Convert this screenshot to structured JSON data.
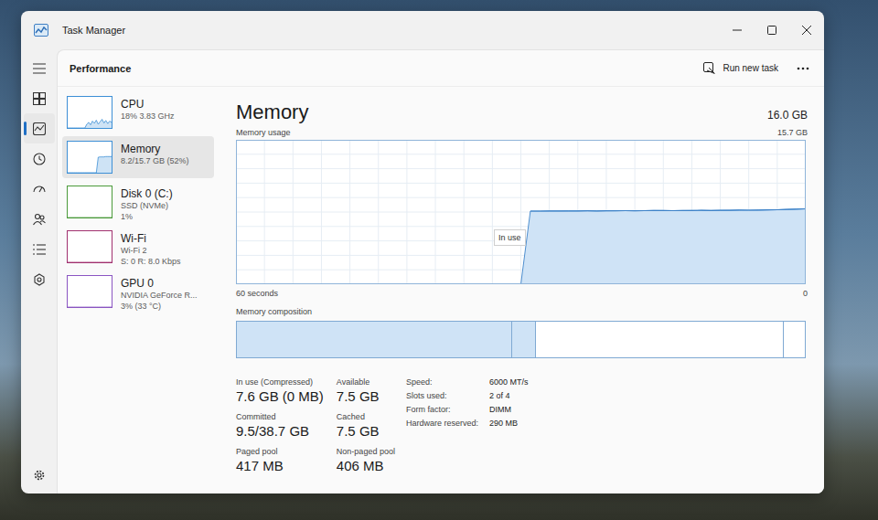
{
  "window": {
    "title": "Task Manager"
  },
  "nav": [
    {
      "kind": "menu",
      "selected": false
    },
    {
      "kind": "processes",
      "selected": false
    },
    {
      "kind": "performance",
      "selected": true
    },
    {
      "kind": "app-history",
      "selected": false
    },
    {
      "kind": "startup",
      "selected": false
    },
    {
      "kind": "users",
      "selected": false
    },
    {
      "kind": "details",
      "selected": false
    },
    {
      "kind": "services",
      "selected": false
    },
    {
      "kind": "settings",
      "selected": false
    }
  ],
  "header": {
    "title": "Performance",
    "run_task": "Run new task"
  },
  "sidebar": {
    "items": [
      {
        "name": "CPU",
        "details": [
          "18% 3.83 GHz"
        ],
        "selected": false,
        "color": "#3d8fd6",
        "values": [
          0,
          0,
          0,
          0,
          0,
          0,
          0,
          0,
          0,
          0,
          12,
          18,
          10,
          22,
          15,
          25,
          12,
          20,
          28,
          16,
          24,
          14,
          22,
          18
        ]
      },
      {
        "name": "Memory",
        "details": [
          "8.2/15.7 GB (52%)"
        ],
        "selected": true,
        "color": "#3d8fd6",
        "values": [
          0,
          0,
          0,
          0,
          0,
          0,
          0,
          0,
          0,
          0,
          0,
          0,
          0,
          0,
          0,
          0,
          50,
          51,
          51,
          51,
          52,
          52,
          52,
          52
        ]
      },
      {
        "name": "Disk 0 (C:)",
        "details": [
          "SSD (NVMe)",
          "1%"
        ],
        "selected": false,
        "color": "#4a9a3a",
        "values": [
          0,
          0,
          0,
          0,
          0,
          0,
          0,
          0,
          0,
          0,
          0,
          0,
          0,
          0,
          0,
          0,
          0,
          0,
          0,
          0,
          0,
          0,
          0,
          0,
          0,
          0,
          0,
          0,
          0,
          0,
          0,
          0,
          0,
          0,
          0,
          0,
          0,
          0,
          0,
          0,
          0,
          0,
          0,
          0,
          0,
          0,
          0,
          0,
          0,
          0,
          0,
          0,
          0,
          0,
          0,
          0,
          0,
          0,
          0,
          0,
          0,
          0,
          0,
          0,
          0,
          0,
          0,
          0,
          0,
          0,
          0,
          0
        ]
      },
      {
        "name": "Wi-Fi",
        "details": [
          "Wi-Fi 2",
          "S: 0 R: 8.0 Kbps"
        ],
        "selected": false,
        "color": "#a1306f",
        "values": [
          0,
          0,
          0,
          0,
          0,
          0,
          0,
          0,
          0,
          0,
          0,
          0,
          0,
          0,
          0,
          0,
          0,
          0,
          0,
          0,
          0,
          0,
          0,
          0
        ]
      },
      {
        "name": "GPU 0",
        "details": [
          "NVIDIA GeForce R...",
          "3% (33 °C)"
        ],
        "selected": false,
        "color": "#8a55c2",
        "values": [
          0,
          0,
          0,
          0,
          0,
          0,
          0,
          0,
          0,
          0,
          0,
          0,
          0,
          0,
          0,
          0,
          0,
          0,
          0,
          0,
          0,
          0,
          0,
          0
        ]
      }
    ]
  },
  "memory": {
    "title": "Memory",
    "capacity": "16.0 GB",
    "usage_label": "Memory usage",
    "max_label": "15.7 GB",
    "max": 15.7,
    "window_seconds": 60,
    "usage_gb": [
      0.0,
      7.95,
      7.95,
      7.96,
      7.96,
      7.97,
      7.97,
      7.98,
      7.97,
      7.98,
      7.99,
      8.0,
      7.99,
      8.0,
      8.02,
      8.01,
      8.0,
      8.01,
      8.02,
      8.03,
      8.02,
      8.03,
      8.04,
      8.06,
      8.05,
      8.06,
      8.08,
      8.1,
      8.13,
      8.17,
      8.2
    ],
    "axis_left": "60 seconds",
    "axis_right": "0",
    "tooltip": "In use",
    "composition_label": "Memory composition",
    "composition": [
      {
        "kind": "in-use",
        "level": 0.484
      },
      {
        "kind": "modified",
        "level": 0.042
      },
      {
        "kind": "standby",
        "level": 0.437
      },
      {
        "kind": "free",
        "level": 0.037
      }
    ],
    "stats": [
      {
        "label": "In use (Compressed)",
        "value": "7.6 GB (0 MB)"
      },
      {
        "label": "Available",
        "value": "7.5 GB"
      },
      {
        "label": "Committed",
        "value": "9.5/38.7 GB"
      },
      {
        "label": "Cached",
        "value": "7.5 GB"
      },
      {
        "label": "Paged pool",
        "value": "417 MB"
      },
      {
        "label": "Non-paged pool",
        "value": "406 MB"
      }
    ],
    "specs": [
      {
        "label": "Speed:",
        "value": "6000 MT/s"
      },
      {
        "label": "Slots used:",
        "value": "2 of 4"
      },
      {
        "label": "Form factor:",
        "value": "DIMM"
      },
      {
        "label": "Hardware reserved:",
        "value": "290 MB"
      }
    ]
  }
}
